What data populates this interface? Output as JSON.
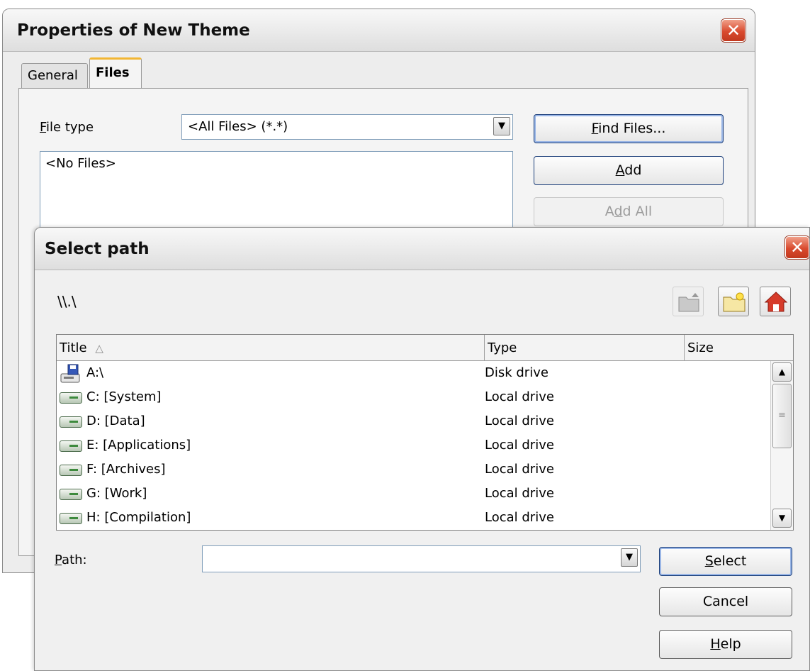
{
  "back_dialog": {
    "title": "Properties of New Theme",
    "close_glyph": "✕",
    "tabs": [
      {
        "label": "General",
        "active": false
      },
      {
        "label": "Files",
        "active": true
      }
    ],
    "file_type_label_mnemonic": "F",
    "file_type_label_rest": "ile type",
    "file_type_value": "<All Files> (*.*)",
    "file_list_empty_text": "<No Files>",
    "find_files_mnemonic": "F",
    "find_files_rest": "ind Files...",
    "add_mnemonic": "A",
    "add_rest": "dd",
    "add_all_pre": "A",
    "add_all_mnemonic": "d",
    "add_all_rest": "d All"
  },
  "select_path_dialog": {
    "title": "Select path",
    "close_glyph": "✕",
    "current_path": "\\\\.\\",
    "toolbar_icons": [
      "folder-up-icon",
      "new-folder-icon",
      "home-icon"
    ],
    "columns": [
      {
        "label": "Title",
        "sort_indicator": "△"
      },
      {
        "label": "Type"
      },
      {
        "label": "Size"
      }
    ],
    "rows": [
      {
        "name": "A:\\",
        "type": "Disk drive",
        "icon": "floppy-drive-icon"
      },
      {
        "name": "C: [System]",
        "type": "Local drive",
        "icon": "hard-drive-icon"
      },
      {
        "name": "D: [Data]",
        "type": "Local drive",
        "icon": "hard-drive-icon"
      },
      {
        "name": "E: [Applications]",
        "type": "Local drive",
        "icon": "hard-drive-icon"
      },
      {
        "name": "F: [Archives]",
        "type": "Local drive",
        "icon": "hard-drive-icon"
      },
      {
        "name": "G: [Work]",
        "type": "Local drive",
        "icon": "hard-drive-icon"
      },
      {
        "name": "H: [Compilation]",
        "type": "Local drive",
        "icon": "hard-drive-icon"
      }
    ],
    "path_label_mnemonic": "P",
    "path_label_rest": "ath:",
    "path_value": "",
    "select_mnemonic": "S",
    "select_rest": "elect",
    "cancel_label": "Cancel",
    "help_mnemonic": "H",
    "help_rest": "elp"
  },
  "colors": {
    "close_button": "#d94a2e",
    "tab_highlight": "#f2b633",
    "default_button_border": "#1c3f7a",
    "field_border": "#7f9db9"
  }
}
